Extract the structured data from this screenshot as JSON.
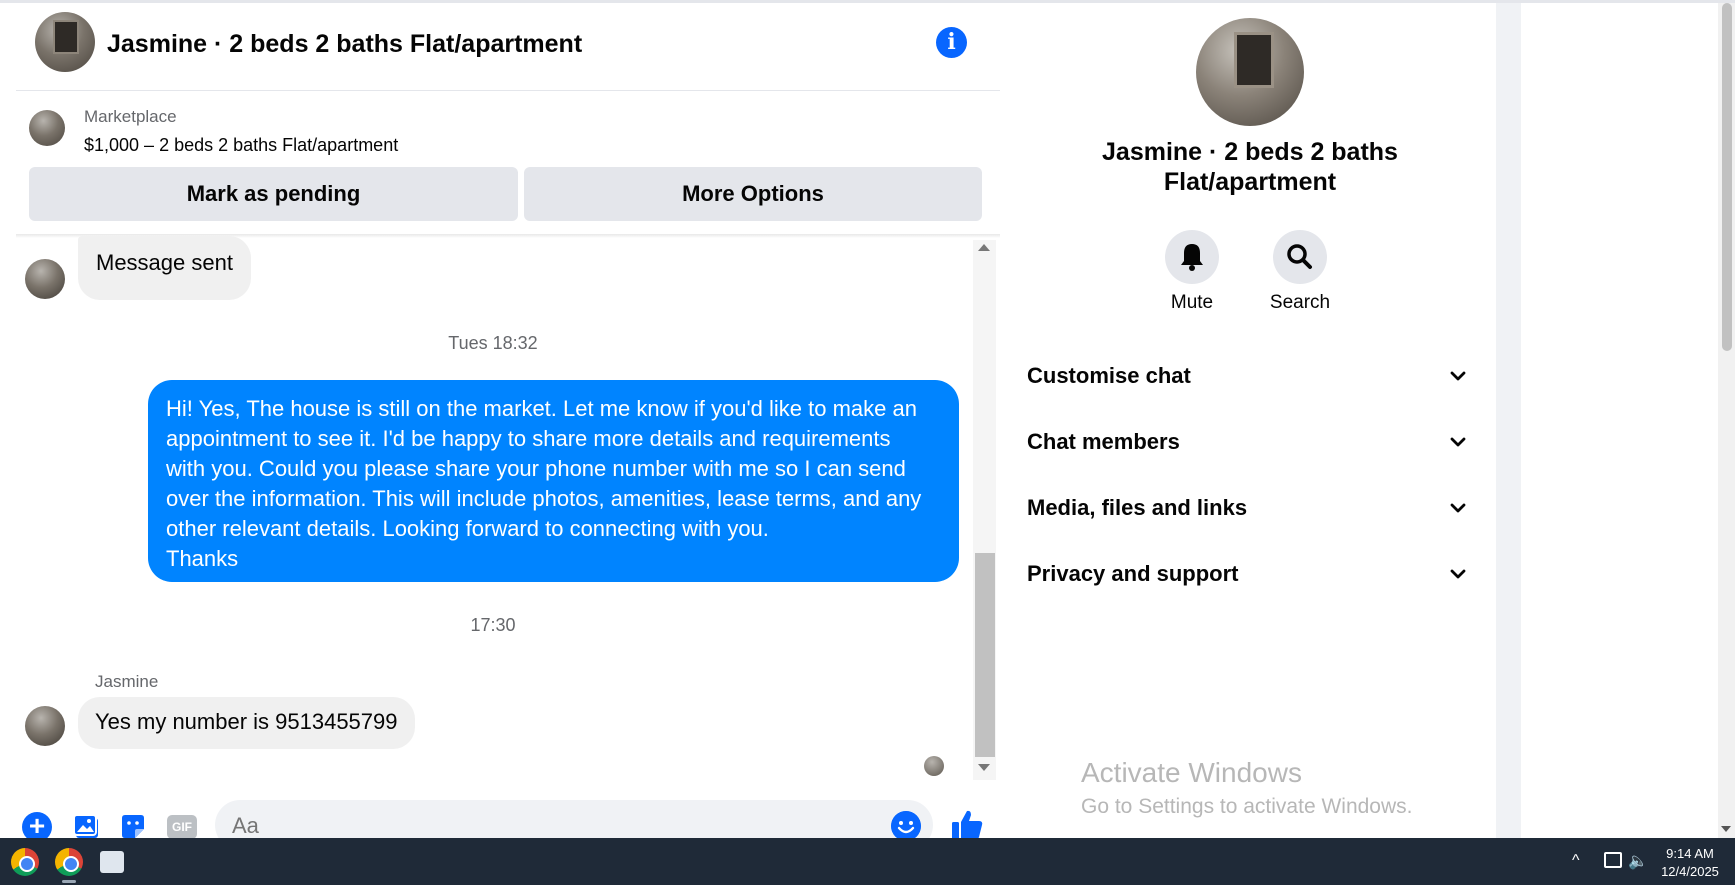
{
  "chat": {
    "header_title": "Jasmine · 2 beds 2 baths Flat/apartment",
    "marketplace_label": "Marketplace",
    "listing_title": "$1,000 – 2 beds 2 baths Flat/apartment",
    "mark_pending_label": "Mark as pending",
    "more_options_label": "More Options"
  },
  "messages": {
    "first_in": "Message sent",
    "timestamp_1": "Tues 18:32",
    "outgoing_lines": [
      "Hi! Yes, The house is still on the market. Let me know if you'd like to make an",
      "appointment to see it. I'd be happy to share more details and requirements",
      "with you. Could you please share your phone number with me so I can send",
      "over the information. This will include photos, amenities, lease terms, and any",
      "other relevant details. Looking forward to connecting with you.",
      "Thanks"
    ],
    "timestamp_2": "17:30",
    "sender_name": "Jasmine",
    "second_in": "Yes my number is 9513455799"
  },
  "composer": {
    "placeholder": "Aa",
    "gif_label": "GIF"
  },
  "right_panel": {
    "name_line1": "Jasmine · 2 beds 2 baths",
    "name_line2": "Flat/apartment",
    "mute_label": "Mute",
    "search_label": "Search",
    "sections": [
      "Customise chat",
      "Chat members",
      "Media, files and links",
      "Privacy and support"
    ]
  },
  "watermark": {
    "line1": "Activate Windows",
    "line2": "Go to Settings to activate Windows."
  },
  "taskbar": {
    "time": "9:14 AM",
    "date": "12/4/2025"
  },
  "colors": {
    "accent": "#0866ff",
    "outgoing_bubble": "#0084ff",
    "incoming_bubble": "#f0f0f0",
    "taskbar": "#1f2a38"
  },
  "icons": [
    "info-icon",
    "plus-icon",
    "photo-icon",
    "sticker-icon",
    "gif-icon",
    "emoji-icon",
    "like-icon",
    "bell-icon",
    "search-icon",
    "chevron-down-icon",
    "chrome-icon",
    "network-icon",
    "volume-icon"
  ]
}
